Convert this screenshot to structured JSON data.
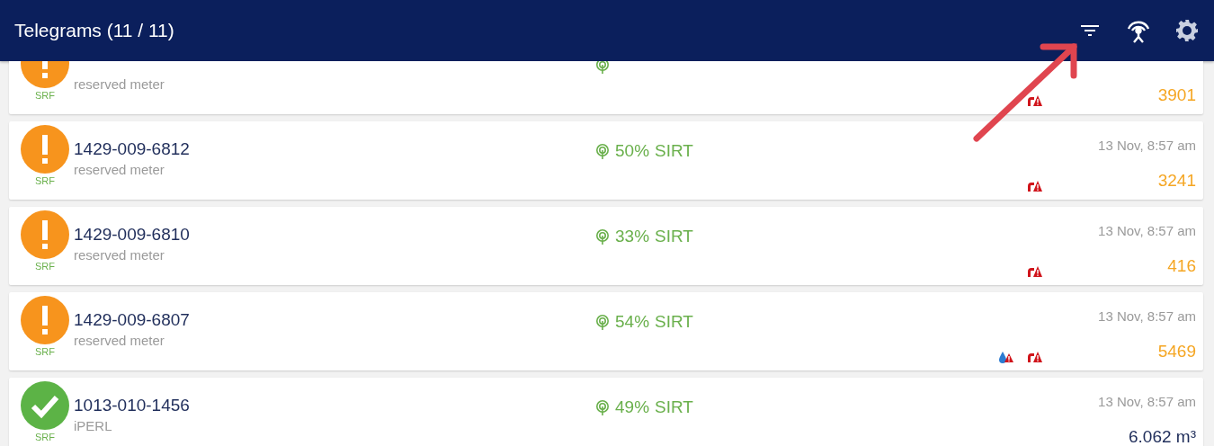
{
  "header": {
    "title": "Telegrams (11 / 11)"
  },
  "telegrams": [
    {
      "kind": "warning",
      "meter": "reserved meter",
      "tag": "SRF",
      "value": "3901",
      "alarms": [
        {
          "kind": "backflow"
        }
      ]
    },
    {
      "kind": "warning",
      "id": "1429-009-6812",
      "meter": "reserved meter",
      "tag": "SRF",
      "signal": "50%",
      "protocol": "SIRT",
      "time": "13 Nov, 8:57 am",
      "value": "3241",
      "alarms": [
        {
          "kind": "backflow"
        }
      ]
    },
    {
      "kind": "warning",
      "id": "1429-009-6810",
      "meter": "reserved meter",
      "tag": "SRF",
      "signal": "33%",
      "protocol": "SIRT",
      "time": "13 Nov, 8:57 am",
      "value": "416",
      "alarms": [
        {
          "kind": "backflow"
        }
      ]
    },
    {
      "kind": "warning",
      "id": "1429-009-6807",
      "meter": "reserved meter",
      "tag": "SRF",
      "signal": "54%",
      "protocol": "SIRT",
      "time": "13 Nov, 8:57 am",
      "value": "5469",
      "alarms": [
        {
          "kind": "leak"
        },
        {
          "kind": "backflow"
        }
      ]
    },
    {
      "kind": "ok",
      "id": "1013-010-1456",
      "meter": "iPERL",
      "tag": "SRF",
      "signal": "49%",
      "protocol": "SIRT",
      "time": "13 Nov, 8:57 am",
      "value": "6.062 m³"
    }
  ]
}
